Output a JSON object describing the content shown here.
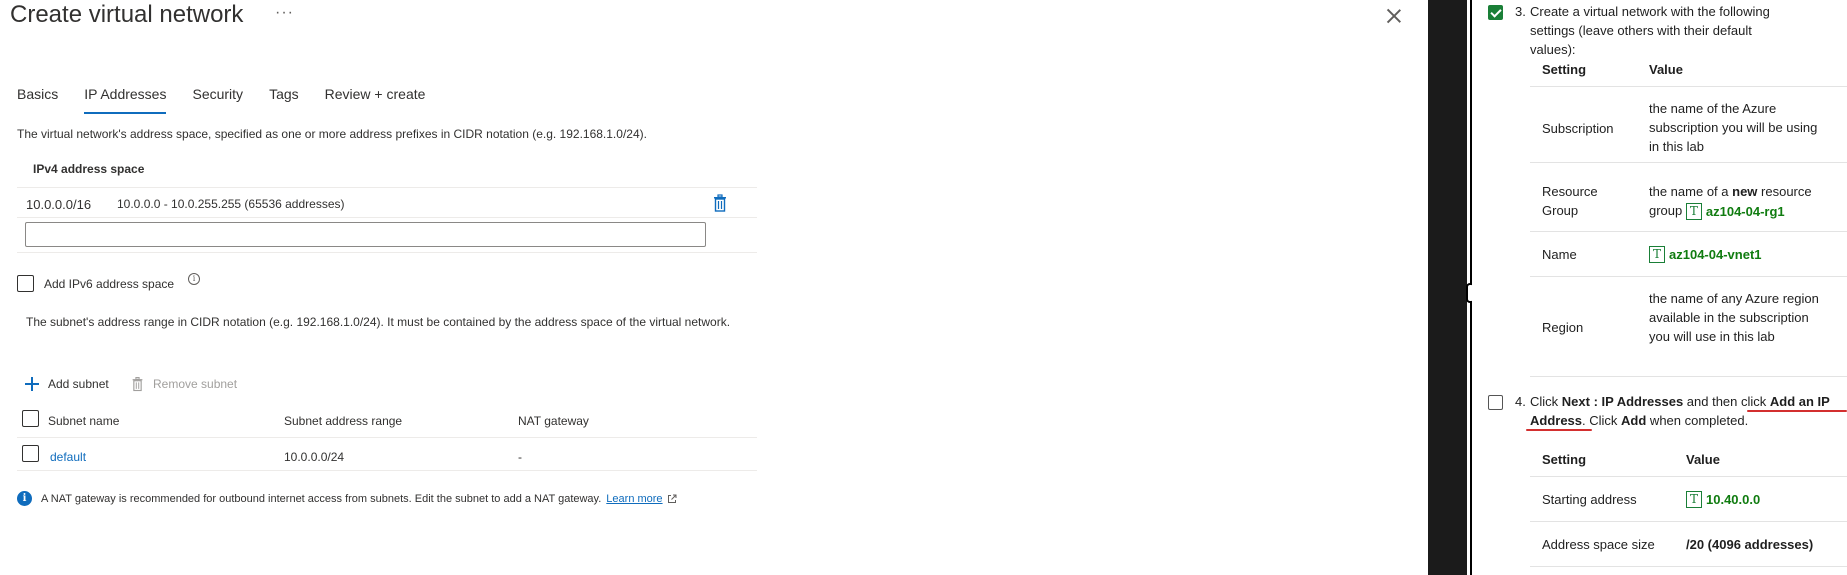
{
  "portal": {
    "title": "Create virtual network",
    "more": "···",
    "tabs": [
      {
        "label": "Basics"
      },
      {
        "label": "IP Addresses"
      },
      {
        "label": "Security"
      },
      {
        "label": "Tags"
      },
      {
        "label": "Review + create"
      }
    ],
    "address_space_description": "The virtual network's address space, specified as one or more address prefixes in CIDR notation (e.g. 192.168.1.0/24).",
    "ipv4_header": "IPv4 address space",
    "ipv4_row": {
      "cidr": "10.0.0.0/16",
      "range": "10.0.0.0 - 10.0.255.255 (65536 addresses)"
    },
    "new_address_value": "",
    "ipv6_label": "Add IPv6 address space",
    "subnet_description": "The subnet's address range in CIDR notation (e.g. 192.168.1.0/24). It must be contained by the address space of the virtual network.",
    "add_subnet": "Add subnet",
    "remove_subnet": "Remove subnet",
    "subnet_table": {
      "headers": [
        "Subnet name",
        "Subnet address range",
        "NAT gateway"
      ],
      "rows": [
        {
          "name": "default",
          "range": "10.0.0.0/24",
          "nat": "-"
        }
      ]
    },
    "nat_info": "A NAT gateway is recommended for outbound internet access from subnets. Edit the subnet to add a NAT gateway.",
    "learn_more": "Learn more"
  },
  "lab": {
    "step3": {
      "number": "3.",
      "text": "Create a virtual network with the following settings (leave others with their default values):",
      "checked": true,
      "headers": [
        "Setting",
        "Value"
      ],
      "rows": [
        {
          "setting": "Subscription",
          "value": "the name of the Azure subscription you will be using in this lab"
        },
        {
          "setting_line1": "Resource",
          "setting_line2": "Group",
          "value_pre": "the name of a ",
          "value_bold": "new",
          "value_post": " resource",
          "value_line2": "group",
          "value_code": "az104-04-rg1"
        },
        {
          "setting": "Name",
          "value_code": "az104-04-vnet1"
        },
        {
          "setting": "Region",
          "value": "the name of any Azure region available in the subscription you will use in this lab"
        }
      ]
    },
    "step4": {
      "number": "4.",
      "click1": "Click ",
      "next_bold": "Next : IP Addresses",
      "mid": " and then click ",
      "add_bold": "Add an IP Address",
      "tail1": ". Click ",
      "add2_bold": "Add",
      "tail2": " when completed.",
      "checked": false,
      "headers": [
        "Setting",
        "Value"
      ],
      "rows": [
        {
          "setting": "Starting address",
          "value_code": "10.40.0.0"
        },
        {
          "setting": "Address space size",
          "value_bold": "/20 (4096 addresses)"
        }
      ]
    },
    "code_icon": "T",
    "accent_green": "#107c10",
    "annotation_red": "#d32f2f"
  }
}
